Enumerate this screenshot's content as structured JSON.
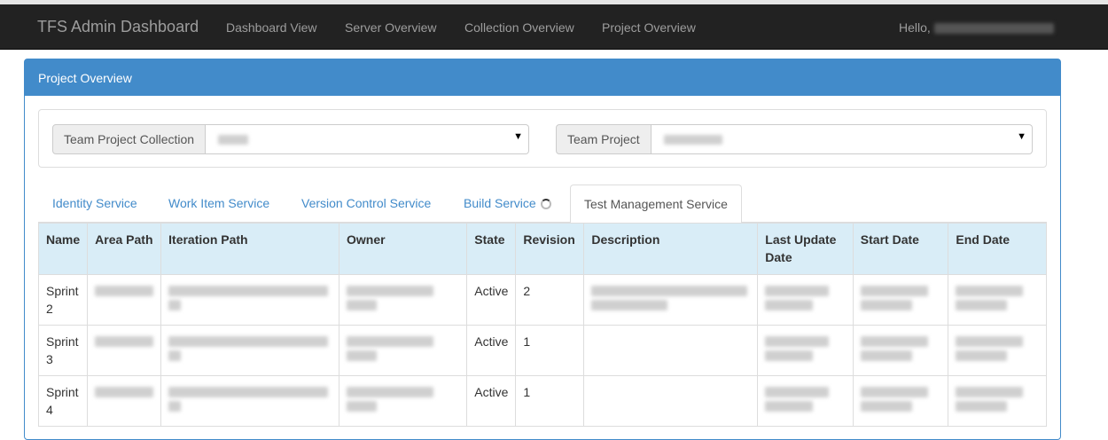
{
  "navbar": {
    "brand": "TFS Admin Dashboard",
    "links": [
      "Dashboard View",
      "Server Overview",
      "Collection Overview",
      "Project Overview"
    ],
    "greeting": "Hello,"
  },
  "panel": {
    "title": "Project Overview",
    "collection_label": "Team Project Collection",
    "project_label": "Team Project"
  },
  "tabs": [
    "Identity Service",
    "Work Item Service",
    "Version Control Service",
    "Build Service",
    "Test Management Service"
  ],
  "active_tab": "Test Management Service",
  "table": {
    "headers": [
      "Name",
      "Area Path",
      "Iteration Path",
      "Owner",
      "State",
      "Revision",
      "Description",
      "Last Update Date",
      "Start Date",
      "End Date"
    ],
    "rows": [
      {
        "name": "Sprint 2",
        "state": "Active",
        "revision": "2"
      },
      {
        "name": "Sprint 3",
        "state": "Active",
        "revision": "1"
      },
      {
        "name": "Sprint 4",
        "state": "Active",
        "revision": "1"
      }
    ]
  },
  "colors": {
    "navbar_bg": "#222222",
    "panel_primary": "#428bca",
    "table_header_bg": "#d9edf7"
  },
  "icons": [
    "caret-down-icon",
    "loading-spinner-icon"
  ]
}
